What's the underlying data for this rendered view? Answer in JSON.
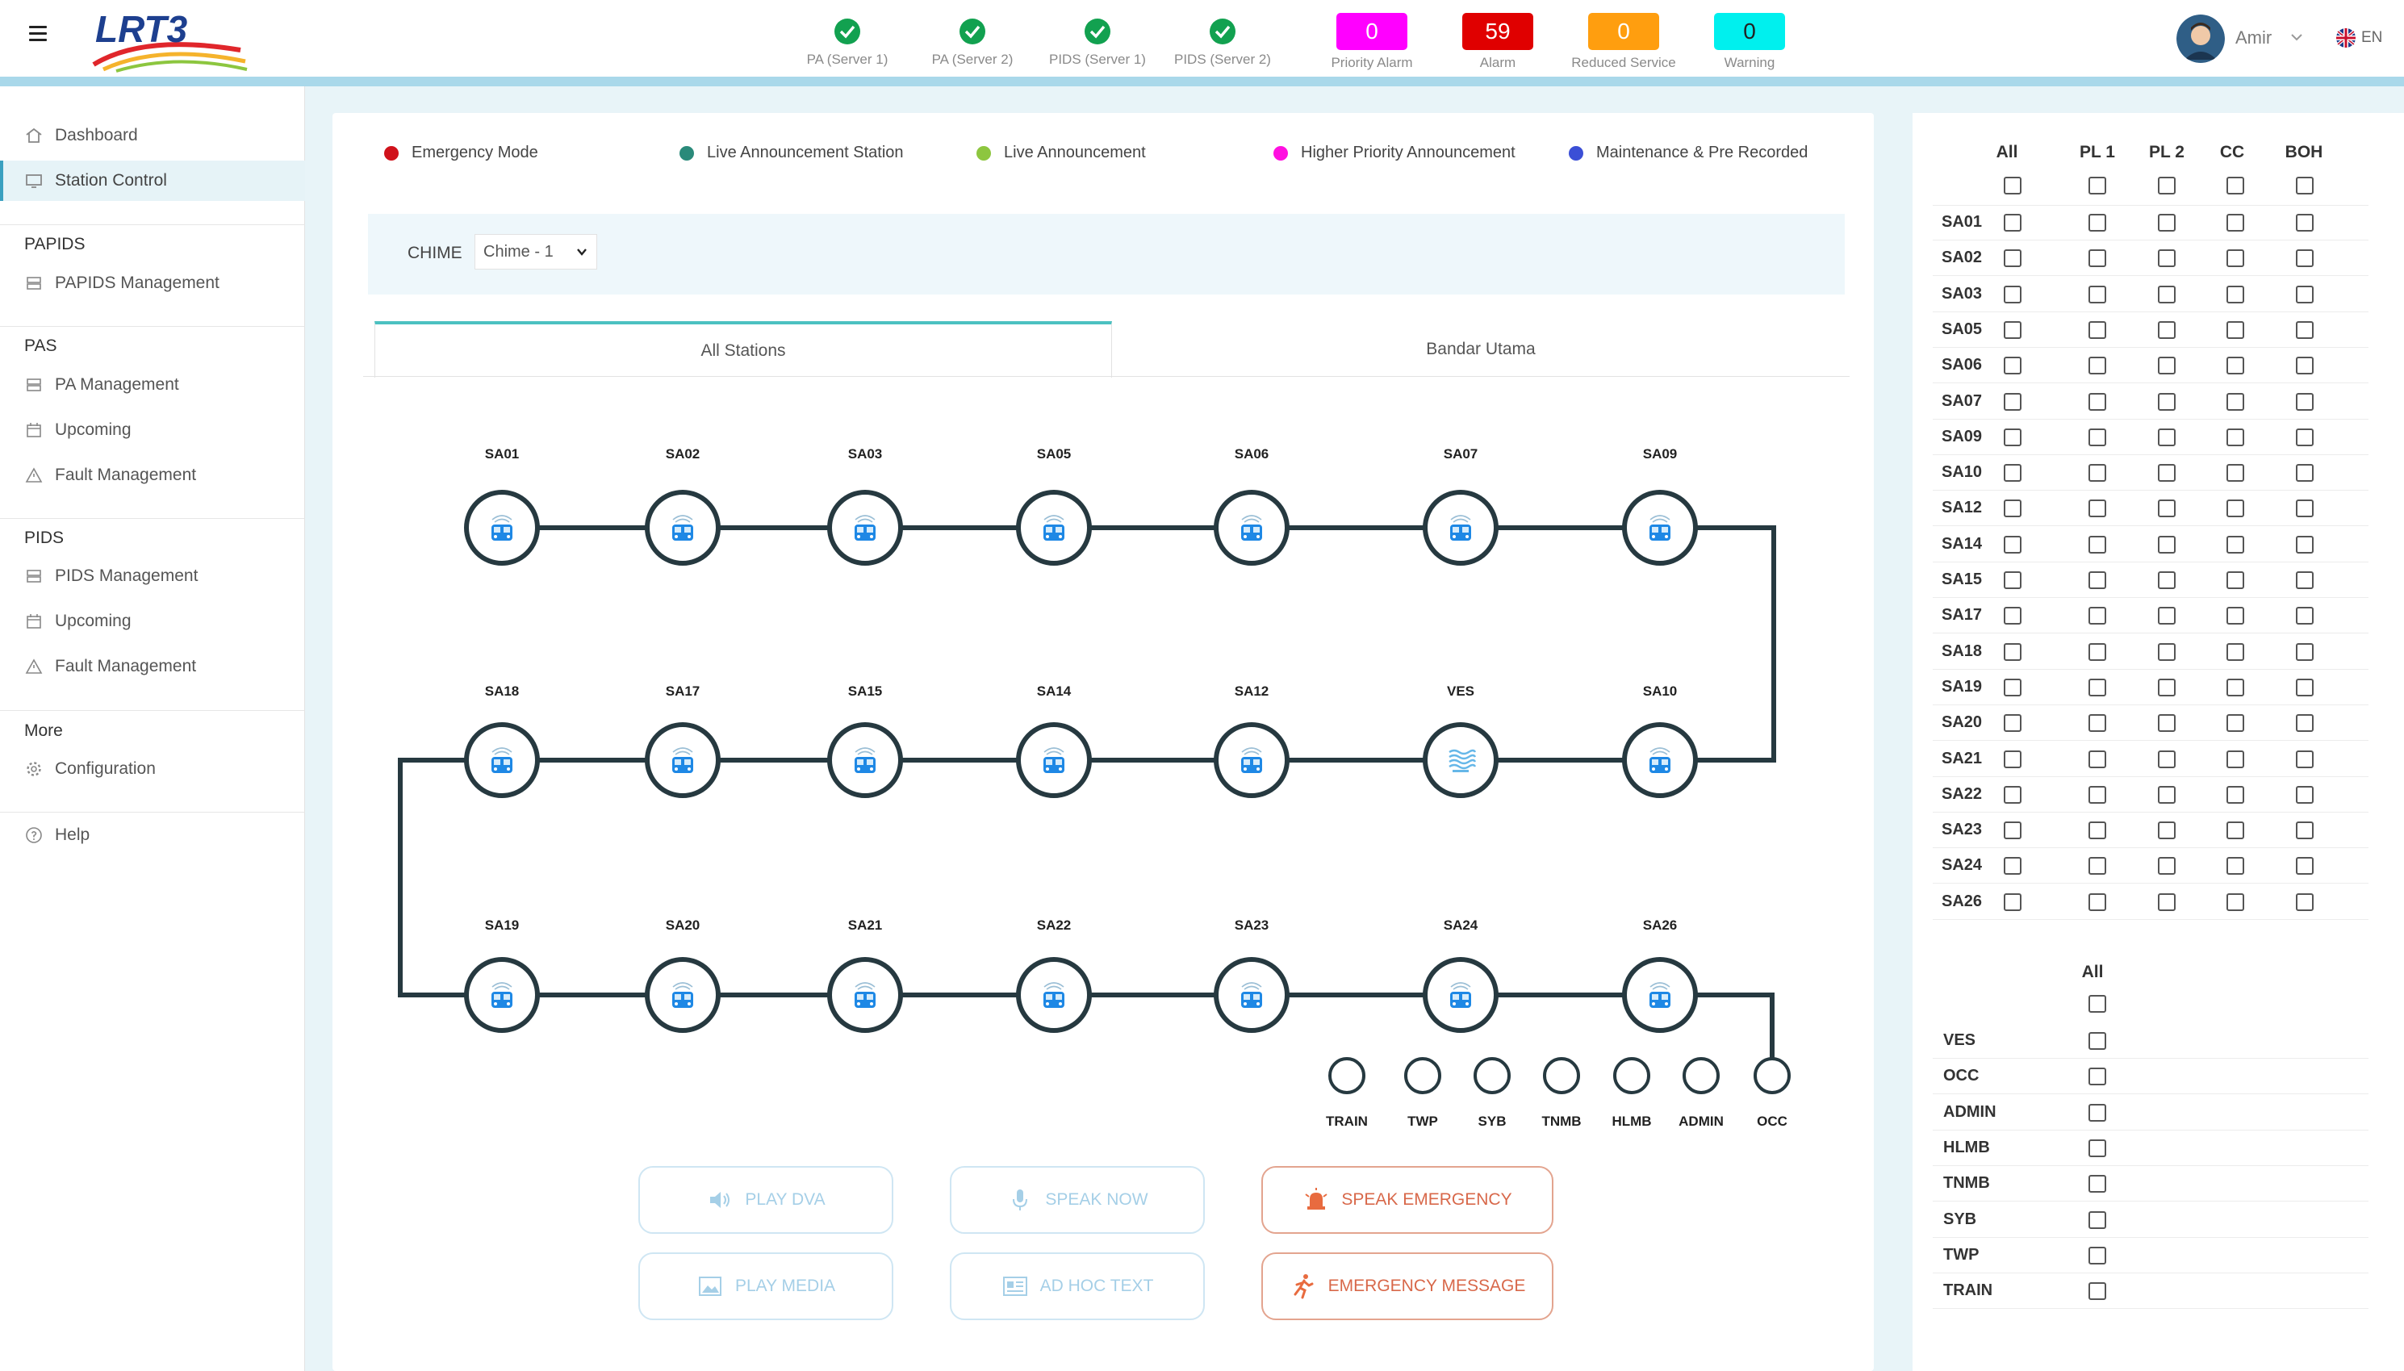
{
  "header": {
    "logo_text": "LRT3",
    "servers": [
      {
        "label": "PA (Server 1)",
        "status": "ok"
      },
      {
        "label": "PA (Server 2)",
        "status": "ok"
      },
      {
        "label": "PIDS (Server 1)",
        "status": "ok"
      },
      {
        "label": "PIDS (Server 2)",
        "status": "ok"
      }
    ],
    "counters": [
      {
        "label": "Priority Alarm",
        "value": "0",
        "bg": "#ff00ff",
        "fg": "#ffffff"
      },
      {
        "label": "Alarm",
        "value": "59",
        "bg": "#e00000",
        "fg": "#ffffff"
      },
      {
        "label": "Reduced Service",
        "value": "0",
        "bg": "#ff9e0f",
        "fg": "#ffffff"
      },
      {
        "label": "Warning",
        "value": "0",
        "bg": "#00f0ee",
        "fg": "#222222"
      }
    ],
    "user_name": "Amir",
    "language": "EN"
  },
  "sidebar": {
    "dashboard": "Dashboard",
    "station_control": "Station Control",
    "papids_section": "PAPIDS",
    "papids_management": "PAPIDS Management",
    "pas_section": "PAS",
    "pa_management": "PA Management",
    "pas_upcoming": "Upcoming",
    "pas_fault": "Fault Management",
    "pids_section": "PIDS",
    "pids_management": "PIDS Management",
    "pids_upcoming": "Upcoming",
    "pids_fault": "Fault Management",
    "more_section": "More",
    "configuration": "Configuration",
    "help": "Help"
  },
  "legend": [
    {
      "label": "Emergency Mode",
      "color": "#d0121b"
    },
    {
      "label": "Live Announcement Station",
      "color": "#2a8a7a"
    },
    {
      "label": "Live Announcement",
      "color": "#8dc63f"
    },
    {
      "label": "Higher Priority Announcement",
      "color": "#ff10e0"
    },
    {
      "label": "Maintenance & Pre Recorded",
      "color": "#3b4fd6"
    }
  ],
  "chime": {
    "label": "CHIME",
    "value": "Chime - 1"
  },
  "tabs": [
    {
      "label": "All Stations",
      "active": true
    },
    {
      "label": "Bandar Utama",
      "active": false
    }
  ],
  "stations": {
    "row1": [
      "SA01",
      "SA02",
      "SA03",
      "SA05",
      "SA06",
      "SA07",
      "SA09"
    ],
    "row2": [
      "SA18",
      "SA17",
      "SA15",
      "SA14",
      "SA12",
      "VES",
      "SA10"
    ],
    "row3": [
      "SA19",
      "SA20",
      "SA21",
      "SA22",
      "SA23",
      "SA24",
      "SA26"
    ],
    "others": [
      "TRAIN",
      "TWP",
      "SYB",
      "TNMB",
      "HLMB",
      "ADMIN",
      "OCC"
    ]
  },
  "buttons": {
    "play_dva": "PLAY DVA",
    "speak_now": "SPEAK NOW",
    "speak_emergency": "SPEAK EMERGENCY",
    "play_media": "PLAY MEDIA",
    "ad_hoc_text": "AD HOC TEXT",
    "emergency_message": "EMERGENCY MESSAGE"
  },
  "right_panel": {
    "columns": [
      "All",
      "PL 1",
      "PL 2",
      "CC",
      "BOH"
    ],
    "station_rows": [
      "SA01",
      "SA02",
      "SA03",
      "SA05",
      "SA06",
      "SA07",
      "SA09",
      "SA10",
      "SA12",
      "SA14",
      "SA15",
      "SA17",
      "SA18",
      "SA19",
      "SA20",
      "SA21",
      "SA22",
      "SA23",
      "SA24",
      "SA26"
    ],
    "other_header": "All",
    "other_rows": [
      "VES",
      "OCC",
      "ADMIN",
      "HLMB",
      "TNMB",
      "SYB",
      "TWP",
      "TRAIN"
    ]
  }
}
